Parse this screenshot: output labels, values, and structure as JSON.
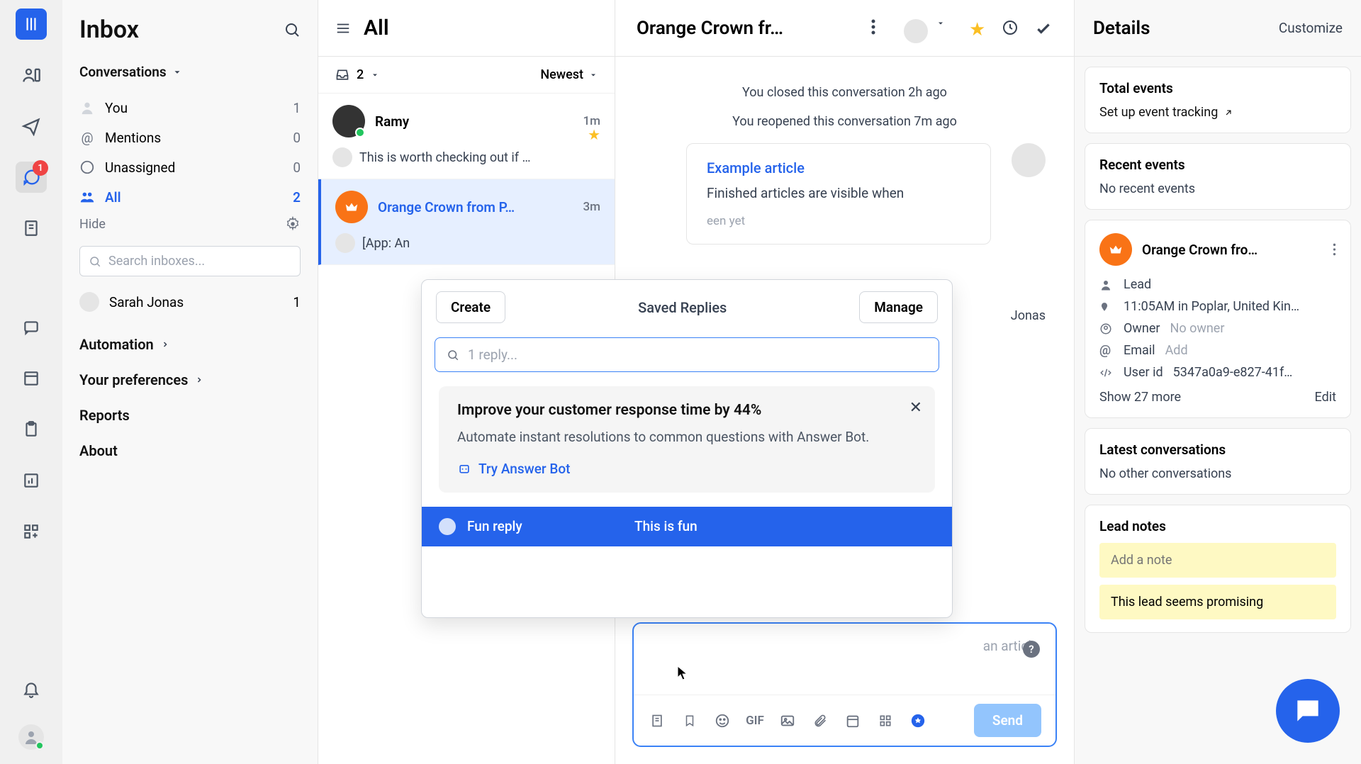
{
  "sidebar": {
    "title": "Inbox",
    "conversations_heading": "Conversations",
    "filters": {
      "you": {
        "label": "You",
        "count": "1"
      },
      "mentions": {
        "label": "Mentions",
        "count": "0"
      },
      "unassigned": {
        "label": "Unassigned",
        "count": "0"
      },
      "all": {
        "label": "All",
        "count": "2"
      }
    },
    "hide": "Hide",
    "search_placeholder": "Search inboxes...",
    "teammate": {
      "name": "Sarah Jonas",
      "count": "1"
    },
    "links": {
      "automation": "Automation",
      "preferences": "Your preferences",
      "reports": "Reports",
      "about": "About"
    },
    "chat_badge": "1"
  },
  "convlist": {
    "title": "All",
    "count": "2",
    "sort": "Newest",
    "items": [
      {
        "name": "Ramy",
        "time": "1m",
        "preview": "This is worth checking out if …"
      },
      {
        "name": "Orange Crown from P…",
        "time": "3m",
        "preview": "[App: An"
      }
    ]
  },
  "thread": {
    "title": "Orange Crown fr…",
    "sys1": "You closed this conversation 2h ago",
    "sys2": "You reopened this conversation 7m ago",
    "article": {
      "title": "Example article",
      "desc": "Finished articles are visible when",
      "meta": "een yet"
    },
    "from_jonas": "Jonas",
    "composer_hint": "an article",
    "send": "Send",
    "gif": "GIF"
  },
  "popup": {
    "create": "Create",
    "title": "Saved Replies",
    "manage": "Manage",
    "search_placeholder": "1 reply...",
    "promo": {
      "heading": "Improve your customer response time by 44%",
      "desc": "Automate instant resolutions to common questions with Answer Bot.",
      "link": "Try Answer Bot"
    },
    "reply": {
      "name": "Fun reply",
      "preview": "This is fun"
    }
  },
  "details": {
    "title": "Details",
    "customize": "Customize",
    "total_events": "Total events",
    "setup_events": "Set up event tracking",
    "recent_events": "Recent events",
    "no_recent": "No recent events",
    "lead": {
      "name": "Orange Crown fro…",
      "type": "Lead",
      "time_loc": "11:05AM in Poplar, United Kin…",
      "owner_label": "Owner",
      "owner_value": "No owner",
      "email_label": "Email",
      "email_value": "Add",
      "userid_label": "User id",
      "userid_value": "5347a0a9-e827-41f…",
      "show_more": "Show 27 more",
      "edit": "Edit"
    },
    "latest_conv": "Latest conversations",
    "no_other": "No other conversations",
    "lead_notes": "Lead notes",
    "add_note": "Add a note",
    "existing_note": "This lead seems promising"
  }
}
